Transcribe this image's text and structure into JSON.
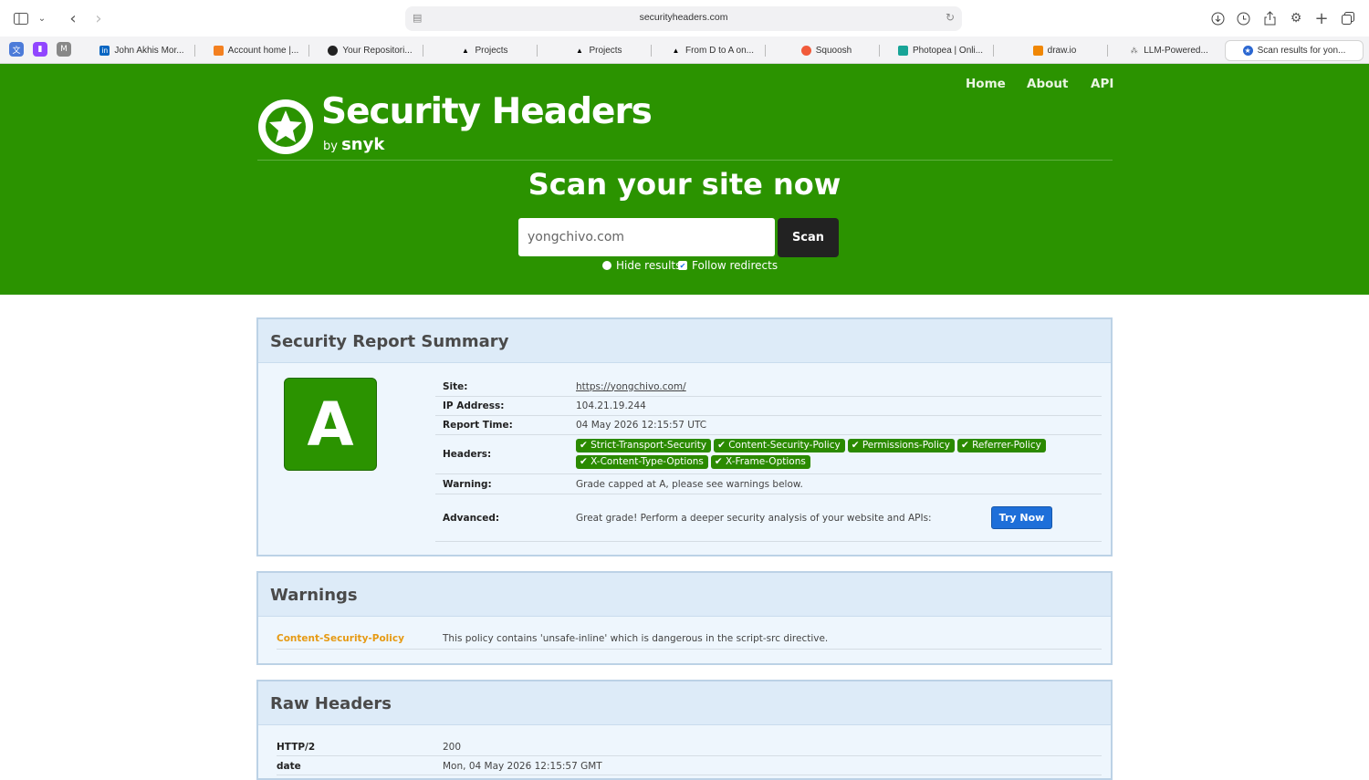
{
  "browser": {
    "url": "securityheaders.com",
    "tabs": [
      {
        "label": "John Akhis Mor..."
      },
      {
        "label": "Account home |..."
      },
      {
        "label": "Your Repositori..."
      },
      {
        "label": "Projects"
      },
      {
        "label": "Projects"
      },
      {
        "label": "From D to A on..."
      },
      {
        "label": "Squoosh"
      },
      {
        "label": "Photopea | Onli..."
      },
      {
        "label": "draw.io"
      },
      {
        "label": "LLM-Powered..."
      },
      {
        "label": "Scan results for yon..."
      }
    ]
  },
  "nav": {
    "home": "Home",
    "about": "About",
    "api": "API"
  },
  "logo": {
    "title": "Security Headers",
    "by": "by",
    "brand": "snyk"
  },
  "hero": {
    "title": "Scan your site now",
    "input_value": "yongchivo.com",
    "scan_label": "Scan",
    "hide_results": "Hide results",
    "follow_redirects": "Follow redirects"
  },
  "summary": {
    "title": "Security Report Summary",
    "grade": "A",
    "site_label": "Site:",
    "site": "https://yongchivo.com/",
    "ip_label": "IP Address:",
    "ip": "104.21.19.244",
    "time_label": "Report Time:",
    "time": "04 May 2026 12:15:57 UTC",
    "headers_label": "Headers:",
    "headers": [
      "Strict-Transport-Security",
      "Content-Security-Policy",
      "Permissions-Policy",
      "Referrer-Policy",
      "X-Content-Type-Options",
      "X-Frame-Options"
    ],
    "warning_label": "Warning:",
    "warning": "Grade capped at A, please see warnings below.",
    "advanced_label": "Advanced:",
    "advanced": "Great grade! Perform a deeper security analysis of your website and APIs:",
    "try_label": "Try Now"
  },
  "warnings": {
    "title": "Warnings",
    "items": [
      {
        "name": "Content-Security-Policy",
        "text": "This policy contains 'unsafe-inline' which is dangerous in the script-src directive."
      }
    ]
  },
  "raw": {
    "title": "Raw Headers",
    "rows": [
      {
        "name": "HTTP/2",
        "value": "200"
      },
      {
        "name": "date",
        "value": "Mon, 04 May 2026 12:15:57 GMT"
      }
    ]
  }
}
